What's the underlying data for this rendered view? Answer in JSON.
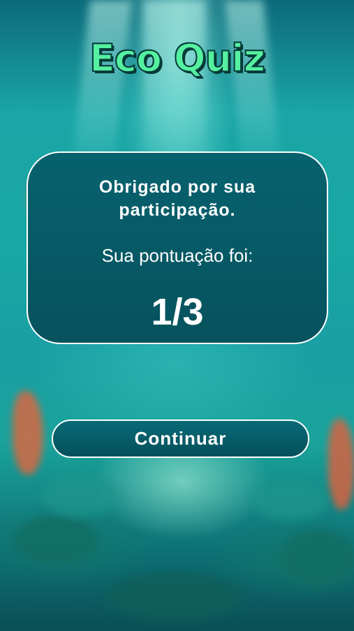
{
  "app": {
    "title": "Eco Quiz"
  },
  "result_card": {
    "thanks_message": "Obrigado por sua participação.",
    "score_label": "Sua pontuação foi:",
    "score": "1/3"
  },
  "actions": {
    "continue_label": "Continuar"
  },
  "colors": {
    "title_text": "#55f0a0",
    "title_outline": "#063d3a",
    "card_background": "#07626e",
    "border": "#ffffff"
  },
  "background": {
    "description_icon": "underwater-scene"
  }
}
